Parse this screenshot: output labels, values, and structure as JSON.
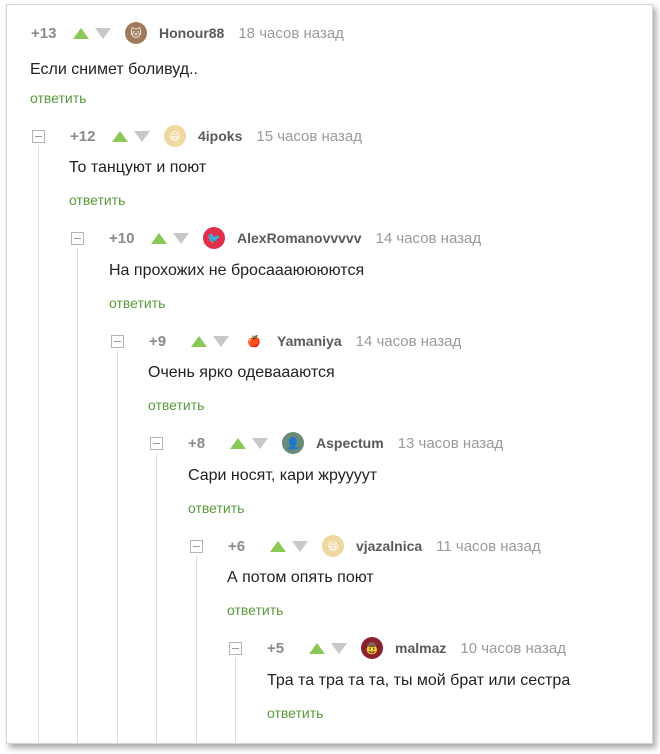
{
  "comments": [
    {
      "rating": "+13",
      "author": "Honour88",
      "time": "18 часов назад",
      "text": "Если снимет боливуд..",
      "reply": "ответить",
      "avatar_color": "#a07a5a",
      "avatar_icon": "cat-avatar"
    },
    {
      "rating": "+12",
      "author": "4ipoks",
      "time": "15 часов назад",
      "text": "То танцуют и поют",
      "reply": "ответить",
      "avatar_color": "#f0d9a0",
      "avatar_icon": "meme-avatar"
    },
    {
      "rating": "+10",
      "author": "AlexRomanovvvvv",
      "time": "14 часов назад",
      "text": "На прохожих не бросаааюююются",
      "reply": "ответить",
      "avatar_color": "#e0304a",
      "avatar_icon": "bird-avatar"
    },
    {
      "rating": "+9",
      "author": "Yamaniya",
      "time": "14 часов назад",
      "text": "Очень ярко одеваааются",
      "reply": "ответить",
      "avatar_color": "#d84030",
      "avatar_icon": "apple-avatar"
    },
    {
      "rating": "+8",
      "author": "Aspectum",
      "time": "13 часов назад",
      "text": "Сари носят, кари жруууут",
      "reply": "ответить",
      "avatar_color": "#6a8a7a",
      "avatar_icon": "photo-avatar"
    },
    {
      "rating": "+6",
      "author": "vjazalnica",
      "time": "11 часов назад",
      "text": "А потом опять поют",
      "reply": "ответить",
      "avatar_color": "#f0d9a0",
      "avatar_icon": "meme-avatar"
    },
    {
      "rating": "+5",
      "author": "malmaz",
      "time": "10 часов назад",
      "text": "Тра та тра та та, ты мой брат или сестра",
      "reply": "ответить",
      "avatar_color": "#8a2030",
      "avatar_icon": "character-avatar"
    }
  ]
}
